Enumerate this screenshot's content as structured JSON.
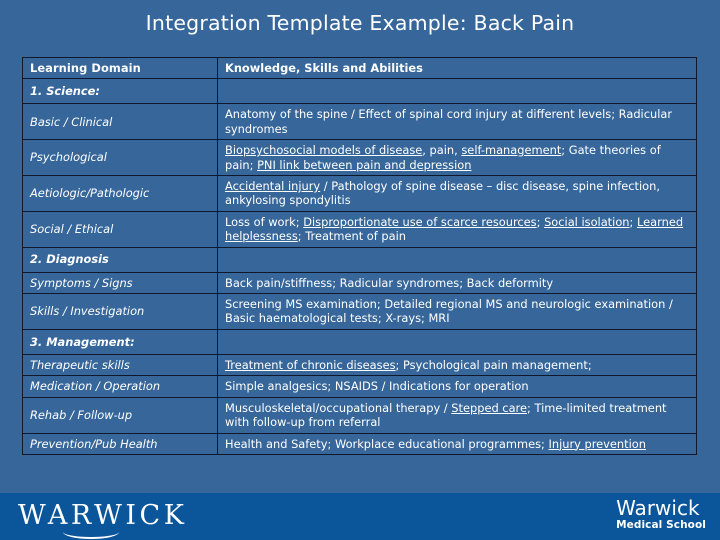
{
  "slide": {
    "title": "Integration Template Example: Back Pain",
    "background_color": "#36669a",
    "footer_color": "#0b559b",
    "text_color": "#ffffff"
  },
  "table": {
    "headers": {
      "domain": "Learning Domain",
      "ksa": "Knowledge, Skills and Abilities"
    },
    "rows": [
      {
        "kind": "section",
        "indent": 0,
        "domain": "1. Science:",
        "ksa": ""
      },
      {
        "kind": "item",
        "indent": 1,
        "domain": "Basic / Clinical",
        "ksa": "Anatomy of the spine / Effect of spinal cord injury at different levels; Radicular syndromes",
        "underlined": []
      },
      {
        "kind": "item",
        "indent": 1,
        "domain": "Psychological",
        "ksa": "Biopsychosocial models of disease, pain, self-management; Gate theories of pain; PNI link between pain and depression",
        "underlined": [
          "Biopsychosocial models of disease",
          "self-management",
          "PNI link between pain and depression"
        ]
      },
      {
        "kind": "item",
        "indent": 1,
        "domain": "Aetiologic/Pathologic",
        "ksa": "Accidental injury / Pathology of spine disease – disc disease, spine infection, ankylosing spondylitis",
        "underlined": [
          "Accidental injury"
        ]
      },
      {
        "kind": "item",
        "indent": 1,
        "domain": "Social / Ethical",
        "ksa": "Loss of work; Disproportionate use of scarce resources; Social isolation; Learned helplessness; Treatment of pain",
        "underlined": [
          "Disproportionate use of scarce resources",
          "Social isolation",
          "Learned helplessness"
        ]
      },
      {
        "kind": "section",
        "indent": 0,
        "domain": "2. Diagnosis",
        "ksa": ""
      },
      {
        "kind": "item",
        "indent": 1,
        "domain": "Symptoms / Signs",
        "ksa": "Back pain/stiffness; Radicular syndromes; Back deformity",
        "underlined": []
      },
      {
        "kind": "item",
        "indent": 1,
        "domain": "Skills / Investigation",
        "ksa": "Screening MS examination; Detailed regional MS and neurologic examination / Basic haematological tests; X-rays; MRI",
        "underlined": []
      },
      {
        "kind": "section",
        "indent": 0,
        "domain": "3. Management:",
        "ksa": ""
      },
      {
        "kind": "item",
        "indent": 2,
        "domain": "Therapeutic skills",
        "ksa": "Treatment of chronic diseases; Psychological pain management;",
        "underlined": [
          "Treatment of chronic diseases"
        ]
      },
      {
        "kind": "item",
        "indent": 2,
        "domain": "Medication / Operation",
        "ksa": "Simple analgesics; NSAIDS / Indications for operation",
        "underlined": []
      },
      {
        "kind": "item",
        "indent": 3,
        "domain": "Rehab / Follow-up",
        "ksa": "Musculoskeletal/occupational therapy / Stepped care; Time-limited treatment with follow-up from referral",
        "underlined": [
          "Stepped care"
        ]
      },
      {
        "kind": "item",
        "indent": 4,
        "domain": "Prevention/Pub Health",
        "ksa": "Health and Safety; Workplace educational programmes; Injury prevention",
        "underlined": [
          "Injury prevention"
        ]
      }
    ]
  },
  "footer": {
    "university_wordmark": "WARWICK",
    "medical_school_name": "Warwick",
    "medical_school_sub": "Medical School"
  }
}
